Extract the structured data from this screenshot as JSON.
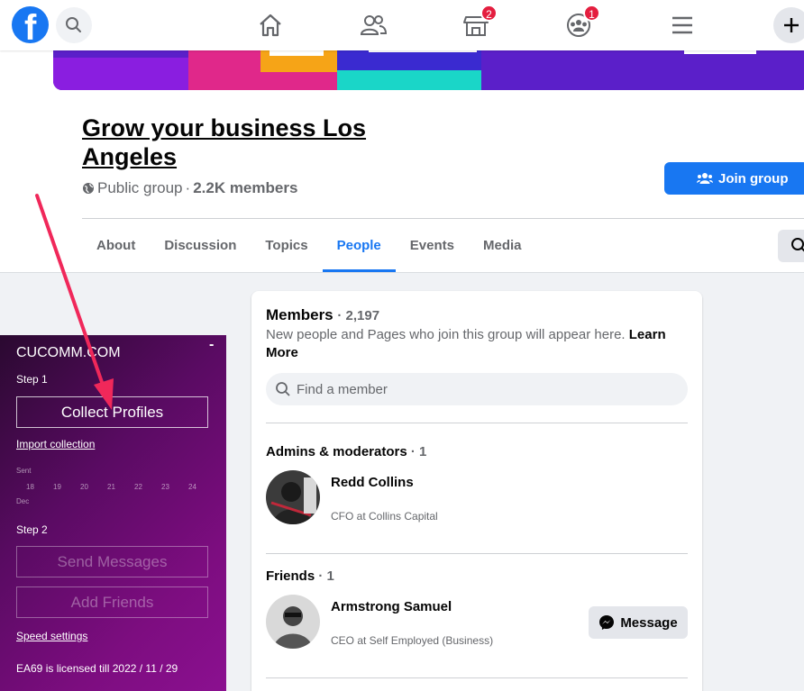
{
  "nav": {
    "logo_letter": "f",
    "marketplace_badge": "2",
    "groups_badge": "1"
  },
  "group": {
    "title": "Grow your business Los Angeles",
    "privacy": "Public group",
    "members": "2.2K members",
    "join_label": "Join group"
  },
  "tabs": [
    "About",
    "Discussion",
    "Topics",
    "People",
    "Events",
    "Media"
  ],
  "active_tab": "People",
  "members_card": {
    "title": "Members",
    "count": "2,197",
    "description": "New people and Pages who join this group will appear here.",
    "learn_more": "Learn More",
    "search_placeholder": "Find a member",
    "admins_title": "Admins & moderators",
    "admins_count": "1",
    "admin": {
      "name": "Redd Collins",
      "subtitle": "CFO at Collins Capital"
    },
    "friends_title": "Friends",
    "friends_count": "1",
    "friend": {
      "name": "Armstrong Samuel",
      "subtitle": "CEO at Self Employed (Business)"
    },
    "message_label": "Message"
  },
  "extension": {
    "title": "CUCOMM.COM",
    "minimize": "-",
    "step1": "Step 1",
    "collect_label": "Collect Profiles",
    "import_link": "Import collection",
    "sent_label": "Sent",
    "days": [
      "18",
      "19",
      "20",
      "21",
      "22",
      "23",
      "24"
    ],
    "month_label": "Dec",
    "step2": "Step 2",
    "send_label": "Send Messages",
    "add_label": "Add Friends",
    "speed_link": "Speed settings",
    "license": "EA69 is licensed till 2022 / 11 / 29"
  },
  "colors": {
    "brand": "#1877f2",
    "badge": "#e41e3f",
    "annotation_arrow": "#f0285a"
  }
}
